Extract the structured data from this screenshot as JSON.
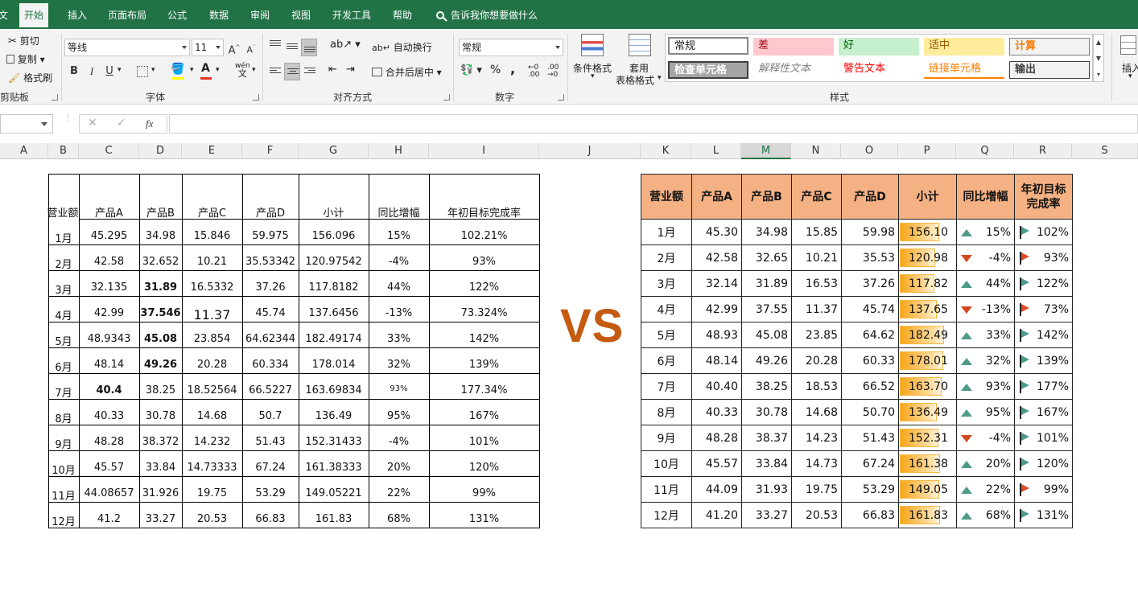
{
  "tabs": [
    {
      "label": "开始",
      "active": true
    },
    {
      "label": "插入"
    },
    {
      "label": "页面布局"
    },
    {
      "label": "公式"
    },
    {
      "label": "数据"
    },
    {
      "label": "审阅"
    },
    {
      "label": "视图"
    },
    {
      "label": "开发工具"
    },
    {
      "label": "帮助"
    }
  ],
  "tell_me": "告诉我你想要做什么",
  "clipboard": {
    "cut": "剪切",
    "copy": "复制",
    "format_painter": "格式刷",
    "label": "剪贴板"
  },
  "font": {
    "name": "等线",
    "size": "11",
    "bold": "B",
    "italic": "I",
    "underline": "U",
    "grow": "A",
    "shrink": "A",
    "phonetic": "wén",
    "label": "字体"
  },
  "alignment": {
    "wrap": "自动换行",
    "merge": "合并后居中",
    "label": "对齐方式"
  },
  "number": {
    "format": "常规",
    "percent": "%",
    "comma": ",",
    "label": "数字"
  },
  "styles": {
    "conditional": "条件格式",
    "table_format_1": "套用",
    "table_format_2": "表格格式",
    "cells": [
      "常规",
      "差",
      "好",
      "适中",
      "计算",
      "检查单元格",
      "解释性文本",
      "警告文本",
      "链接单元格",
      "输出"
    ],
    "label": "样式"
  },
  "cells_group": {
    "insert": "插入"
  },
  "formula_bar": {
    "fx": "fx",
    "cancel": "✕",
    "enter": "✓"
  },
  "columns": [
    "A",
    "B",
    "C",
    "D",
    "E",
    "F",
    "G",
    "H",
    "I",
    "J",
    "K",
    "L",
    "M",
    "N",
    "O",
    "P",
    "Q",
    "R",
    "S"
  ],
  "raw_table": {
    "headers": [
      "营业额",
      "产品A",
      "产品B",
      "产品C",
      "产品D",
      "小计",
      "同比增幅",
      "年初目标完成率"
    ],
    "rows": [
      [
        "1月",
        "45.295",
        "34.98",
        "15.846",
        "59.975",
        "156.096",
        "15%",
        "102.21%"
      ],
      [
        "2月",
        "42.58",
        "32.652",
        "10.21",
        "35.53342",
        "120.97542",
        "-4%",
        "93%"
      ],
      [
        "3月",
        "32.135",
        "31.89",
        "16.5332",
        "37.26",
        "117.8182",
        "44%",
        "122%"
      ],
      [
        "4月",
        "42.99",
        "37.546",
        "11.37",
        "45.74",
        "137.6456",
        "-13%",
        "73.324%"
      ],
      [
        "5月",
        "48.9343",
        "45.08",
        "23.854",
        "64.62344",
        "182.49174",
        "33%",
        "142%"
      ],
      [
        "6月",
        "48.14",
        "49.26",
        "20.28",
        "60.334",
        "178.014",
        "32%",
        "139%"
      ],
      [
        "7月",
        "40.4",
        "38.25",
        "18.52564",
        "66.5227",
        "163.69834",
        "93%",
        "177.34%"
      ],
      [
        "8月",
        "40.33",
        "30.78",
        "14.68",
        "50.7",
        "136.49",
        "95%",
        "167%"
      ],
      [
        "9月",
        "48.28",
        "38.372",
        "14.232",
        "51.43",
        "152.31433",
        "-4%",
        "101%"
      ],
      [
        "10月",
        "45.57",
        "33.84",
        "14.73333",
        "67.24",
        "161.38333",
        "20%",
        "120%"
      ],
      [
        "11月",
        "44.08657",
        "31.926",
        "19.75",
        "53.29",
        "149.05221",
        "22%",
        "99%"
      ],
      [
        "12月",
        "41.2",
        "33.27",
        "20.53",
        "66.83",
        "161.83",
        "68%",
        "131%"
      ]
    ]
  },
  "vs_text": "VS",
  "formatted_table": {
    "headers": [
      "营业额",
      "产品A",
      "产品B",
      "产品C",
      "产品D",
      "小计",
      "同比增幅",
      "年初目标完成率"
    ],
    "rows": [
      {
        "month": "1月",
        "a": "45.30",
        "b": "34.98",
        "c": "15.85",
        "d": "59.98",
        "subtotal": "156.10",
        "bar": 0.7,
        "yoy": "15%",
        "yoy_dir": "up",
        "target": "102%",
        "flag": "green"
      },
      {
        "month": "2月",
        "a": "42.58",
        "b": "32.65",
        "c": "10.21",
        "d": "35.53",
        "subtotal": "120.98",
        "bar": 0.63,
        "yoy": "-4%",
        "yoy_dir": "down",
        "target": "93%",
        "flag": "red"
      },
      {
        "month": "3月",
        "a": "32.14",
        "b": "31.89",
        "c": "16.53",
        "d": "37.26",
        "subtotal": "117.82",
        "bar": 0.62,
        "yoy": "44%",
        "yoy_dir": "up",
        "target": "122%",
        "flag": "green"
      },
      {
        "month": "4月",
        "a": "42.99",
        "b": "37.55",
        "c": "11.37",
        "d": "45.74",
        "subtotal": "137.65",
        "bar": 0.66,
        "yoy": "-13%",
        "yoy_dir": "down",
        "target": "73%",
        "flag": "red"
      },
      {
        "month": "5月",
        "a": "48.93",
        "b": "45.08",
        "c": "23.85",
        "d": "64.62",
        "subtotal": "182.49",
        "bar": 0.78,
        "yoy": "33%",
        "yoy_dir": "up",
        "target": "142%",
        "flag": "green"
      },
      {
        "month": "6月",
        "a": "48.14",
        "b": "49.26",
        "c": "20.28",
        "d": "60.33",
        "subtotal": "178.01",
        "bar": 0.77,
        "yoy": "32%",
        "yoy_dir": "up",
        "target": "139%",
        "flag": "green"
      },
      {
        "month": "7月",
        "a": "40.40",
        "b": "38.25",
        "c": "18.53",
        "d": "66.52",
        "subtotal": "163.70",
        "bar": 0.74,
        "yoy": "93%",
        "yoy_dir": "up",
        "target": "177%",
        "flag": "green"
      },
      {
        "month": "8月",
        "a": "40.33",
        "b": "30.78",
        "c": "14.68",
        "d": "50.70",
        "subtotal": "136.49",
        "bar": 0.66,
        "yoy": "95%",
        "yoy_dir": "up",
        "target": "167%",
        "flag": "green"
      },
      {
        "month": "9月",
        "a": "48.28",
        "b": "38.37",
        "c": "14.23",
        "d": "51.43",
        "subtotal": "152.31",
        "bar": 0.69,
        "yoy": "-4%",
        "yoy_dir": "down",
        "target": "101%",
        "flag": "green"
      },
      {
        "month": "10月",
        "a": "45.57",
        "b": "33.84",
        "c": "14.73",
        "d": "67.24",
        "subtotal": "161.38",
        "bar": 0.72,
        "yoy": "20%",
        "yoy_dir": "up",
        "target": "120%",
        "flag": "green"
      },
      {
        "month": "11月",
        "a": "44.09",
        "b": "31.93",
        "c": "19.75",
        "d": "53.29",
        "subtotal": "149.05",
        "bar": 0.7,
        "yoy": "22%",
        "yoy_dir": "up",
        "target": "99%",
        "flag": "red"
      },
      {
        "month": "12月",
        "a": "41.20",
        "b": "33.27",
        "c": "20.53",
        "d": "66.83",
        "subtotal": "161.83",
        "bar": 0.72,
        "yoy": "68%",
        "yoy_dir": "up",
        "target": "131%",
        "flag": "green"
      }
    ]
  },
  "colors": {
    "excel_green": "#217346",
    "header_fill": "#f4b183",
    "vs": "#c55a11",
    "up": "#4e9a8a",
    "down": "#d0491e"
  }
}
